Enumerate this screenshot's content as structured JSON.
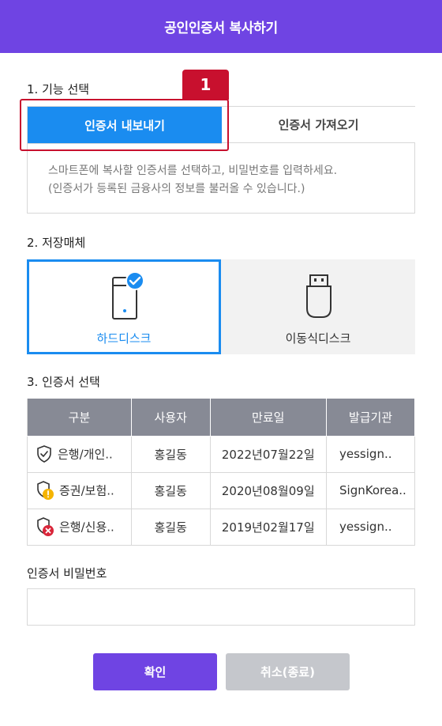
{
  "header": {
    "title": "공인인증서 복사하기"
  },
  "step_badge": "1",
  "sections": {
    "function": "1. 기능 선택",
    "storage": "2. 저장매체",
    "certificate": "3. 인증서 선택",
    "password": "인증서 비밀번호"
  },
  "function_tabs": {
    "export": "인증서 내보내기",
    "import": "인증서 가져오기",
    "active": "export",
    "description_line1": "스마트폰에 복사할 인증서를 선택하고, 비밀번호를 입력하세요.",
    "description_line2": "(인증서가 등록된 금융사의 정보를 불러올 수 있습니다.)"
  },
  "storage": {
    "hard_disk": "하드디스크",
    "removable_disk": "이동식디스크",
    "selected": "hard_disk"
  },
  "table": {
    "headers": [
      "구분",
      "사용자",
      "만료일",
      "발급기관"
    ],
    "rows": [
      {
        "status_icon": "shield-valid-icon",
        "type": "은행/개인..",
        "user": "홍길동",
        "expiry": "2022년07월22일",
        "issuer": "yessign.."
      },
      {
        "status_icon": "shield-warning-icon",
        "type": "증권/보험..",
        "user": "홍길동",
        "expiry": "2020년08월09일",
        "issuer": "SignKorea.."
      },
      {
        "status_icon": "shield-expired-icon",
        "type": "은행/신용..",
        "user": "홍길동",
        "expiry": "2019년02월17일",
        "issuer": "yessign.."
      }
    ]
  },
  "password": {
    "value": "",
    "placeholder": ""
  },
  "buttons": {
    "confirm": "확인",
    "cancel": "취소(종료)"
  },
  "colors": {
    "header": "#6f44e3",
    "accent_blue": "#1a8cf0",
    "highlight_red": "#c8102e",
    "table_header": "#878a95",
    "confirm_button": "#6f44e3",
    "cancel_button": "#c5c7cc",
    "warning": "#f5b400",
    "error": "#d9263a"
  }
}
